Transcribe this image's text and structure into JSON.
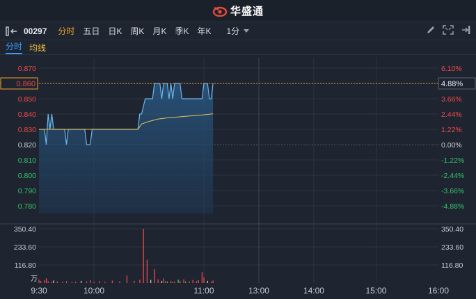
{
  "header": {
    "brand": "华盛通"
  },
  "toolbar": {
    "code": "00297",
    "tabs": [
      "分时",
      "五日",
      "日K",
      "周K",
      "月K",
      "季K",
      "年K"
    ],
    "active_tab": "分时",
    "interval": "1分"
  },
  "subtabs": {
    "intraday": "分时",
    "avg_line": "均线"
  },
  "price_axis": {
    "left_ticks": [
      "0.870",
      "0.860",
      "0.850",
      "0.840",
      "0.830",
      "0.820",
      "0.810",
      "0.800",
      "0.790",
      "0.780"
    ],
    "right_ticks": [
      "6.10%",
      "4.88%",
      "3.66%",
      "2.44%",
      "1.22%",
      "0.00%",
      "-1.22%",
      "-2.44%",
      "-3.66%",
      "-4.88%"
    ],
    "current_price": "0.860",
    "current_pct": "4.88%"
  },
  "volume_axis": {
    "left_ticks": [
      "350.40",
      "233.60",
      "116.80"
    ],
    "right_ticks": [
      "350.40",
      "233.60",
      "116.80"
    ],
    "unit": "万"
  },
  "time_axis": [
    "9:30",
    "10:00",
    "11:00",
    "13:00",
    "14:00",
    "15:00",
    "16:00"
  ],
  "colors": {
    "price_line": "#6ab8ee",
    "avg_line": "#e8c45a",
    "up": "#f04848",
    "down": "#36c26a",
    "neutral": "#c8cdd4",
    "highlight": "#f0a22e"
  },
  "chart_data": {
    "type": "line",
    "prev_close": 0.82,
    "ylim": [
      0.775,
      0.875
    ],
    "series": [
      {
        "name": "分时",
        "points": [
          [
            0,
            0.83
          ],
          [
            3,
            0.83
          ],
          [
            4,
            0.82
          ],
          [
            5,
            0.84
          ],
          [
            6,
            0.83
          ],
          [
            7,
            0.84
          ],
          [
            8,
            0.83
          ],
          [
            14,
            0.83
          ],
          [
            15,
            0.82
          ],
          [
            16,
            0.83
          ],
          [
            25,
            0.83
          ],
          [
            26,
            0.82
          ],
          [
            28,
            0.82
          ],
          [
            29,
            0.83
          ],
          [
            54,
            0.83
          ],
          [
            55,
            0.84
          ],
          [
            56,
            0.84
          ],
          [
            58,
            0.85
          ],
          [
            62,
            0.85
          ],
          [
            63,
            0.86
          ],
          [
            66,
            0.86
          ],
          [
            67,
            0.85
          ],
          [
            68,
            0.86
          ],
          [
            70,
            0.86
          ],
          [
            71,
            0.85
          ],
          [
            72,
            0.86
          ],
          [
            73,
            0.85
          ],
          [
            74,
            0.86
          ],
          [
            77,
            0.86
          ],
          [
            78,
            0.85
          ],
          [
            89,
            0.85
          ],
          [
            90,
            0.86
          ],
          [
            92,
            0.86
          ],
          [
            93,
            0.85
          ],
          [
            94,
            0.85
          ],
          [
            95,
            0.86
          ]
        ]
      },
      {
        "name": "均线",
        "points": [
          [
            0,
            0.83
          ],
          [
            10,
            0.83
          ],
          [
            20,
            0.83
          ],
          [
            54,
            0.83
          ],
          [
            56,
            0.8335
          ],
          [
            60,
            0.8352
          ],
          [
            65,
            0.8367
          ],
          [
            70,
            0.8375
          ],
          [
            75,
            0.838
          ],
          [
            80,
            0.8385
          ],
          [
            85,
            0.839
          ],
          [
            90,
            0.8395
          ],
          [
            95,
            0.8402
          ]
        ]
      }
    ],
    "volume_max": 350.4,
    "volume": [
      {
        "i": 0,
        "v": 22,
        "c": "up"
      },
      {
        "i": 1,
        "v": 14,
        "c": "up"
      },
      {
        "i": 3,
        "v": 18,
        "c": "up"
      },
      {
        "i": 4,
        "v": 30,
        "c": "up"
      },
      {
        "i": 5,
        "v": 12,
        "c": "up"
      },
      {
        "i": 7,
        "v": 9,
        "c": "up"
      },
      {
        "i": 8,
        "v": 16,
        "c": "neutral"
      },
      {
        "i": 10,
        "v": 10,
        "c": "up"
      },
      {
        "i": 13,
        "v": 8,
        "c": "up"
      },
      {
        "i": 15,
        "v": 12,
        "c": "up"
      },
      {
        "i": 18,
        "v": 6,
        "c": "up"
      },
      {
        "i": 20,
        "v": 9,
        "c": "up"
      },
      {
        "i": 23,
        "v": 14,
        "c": "neutral"
      },
      {
        "i": 26,
        "v": 10,
        "c": "up"
      },
      {
        "i": 28,
        "v": 18,
        "c": "up"
      },
      {
        "i": 30,
        "v": 8,
        "c": "up"
      },
      {
        "i": 33,
        "v": 12,
        "c": "up"
      },
      {
        "i": 36,
        "v": 8,
        "c": "up"
      },
      {
        "i": 40,
        "v": 16,
        "c": "up"
      },
      {
        "i": 44,
        "v": 10,
        "c": "up"
      },
      {
        "i": 48,
        "v": 48,
        "c": "up"
      },
      {
        "i": 52,
        "v": 14,
        "c": "up"
      },
      {
        "i": 55,
        "v": 22,
        "c": "up"
      },
      {
        "i": 57,
        "v": 350,
        "c": "up"
      },
      {
        "i": 59,
        "v": 150,
        "c": "up"
      },
      {
        "i": 61,
        "v": 20,
        "c": "neutral"
      },
      {
        "i": 63,
        "v": 90,
        "c": "up"
      },
      {
        "i": 65,
        "v": 24,
        "c": "up"
      },
      {
        "i": 67,
        "v": 14,
        "c": "neutral"
      },
      {
        "i": 68,
        "v": 30,
        "c": "up"
      },
      {
        "i": 69,
        "v": 12,
        "c": "up"
      },
      {
        "i": 70,
        "v": 10,
        "c": "down"
      },
      {
        "i": 72,
        "v": 14,
        "c": "up"
      },
      {
        "i": 73,
        "v": 8,
        "c": "up"
      },
      {
        "i": 74,
        "v": 10,
        "c": "up"
      },
      {
        "i": 76,
        "v": 22,
        "c": "down"
      },
      {
        "i": 77,
        "v": 14,
        "c": "up"
      },
      {
        "i": 79,
        "v": 24,
        "c": "up"
      },
      {
        "i": 80,
        "v": 10,
        "c": "down"
      },
      {
        "i": 82,
        "v": 12,
        "c": "up"
      },
      {
        "i": 84,
        "v": 20,
        "c": "up"
      },
      {
        "i": 86,
        "v": 12,
        "c": "up"
      },
      {
        "i": 87,
        "v": 18,
        "c": "up"
      },
      {
        "i": 89,
        "v": 70,
        "c": "up"
      },
      {
        "i": 90,
        "v": 36,
        "c": "up"
      },
      {
        "i": 92,
        "v": 14,
        "c": "neutral"
      },
      {
        "i": 94,
        "v": 10,
        "c": "up"
      },
      {
        "i": 95,
        "v": 16,
        "c": "up"
      }
    ]
  }
}
